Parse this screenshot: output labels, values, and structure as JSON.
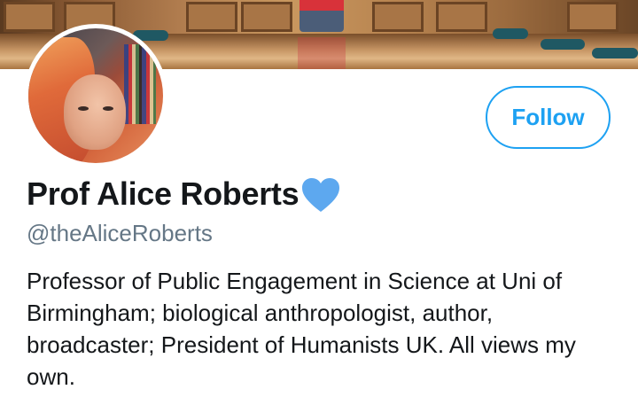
{
  "profile": {
    "name": "Prof Alice Roberts",
    "handle": "@theAliceRoberts",
    "bio": "Professor of Public Engagement in Science at Uni of Birmingham; biological anthropologist, author, broadcaster; President of Humanists UK. All views my own.",
    "badge_icon": "blue-heart-icon"
  },
  "actions": {
    "follow_label": "Follow"
  },
  "colors": {
    "accent": "#1da1f2",
    "heart": "#5da8ef",
    "text_primary": "#14171a",
    "text_secondary": "#657786"
  }
}
